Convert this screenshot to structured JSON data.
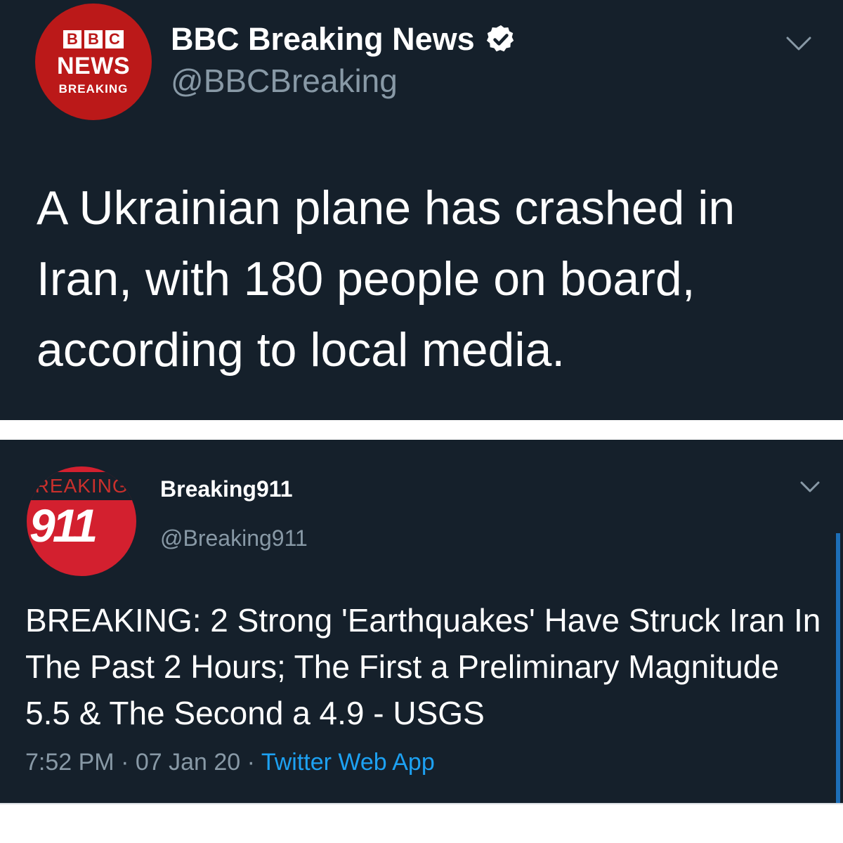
{
  "tweet1": {
    "avatar": {
      "blocks": [
        "B",
        "B",
        "C"
      ],
      "line1": "NEWS",
      "line2": "BREAKING"
    },
    "display_name": "BBC Breaking News",
    "handle": "@BBCBreaking",
    "verified": true,
    "text": "A Ukrainian plane has crashed in Iran, with 180 people on board, according to local media."
  },
  "tweet2": {
    "avatar": {
      "word": "BREAKING",
      "number": "911"
    },
    "display_name": "Breaking911",
    "handle": "@Breaking911",
    "text": "BREAKING: 2 Strong 'Earthquakes' Have Struck Iran In The Past 2 Hours; The First a Preliminary Magnitude 5.5 & The Second a 4.9 - USGS",
    "time": "7:52 PM",
    "date": "07 Jan 20",
    "separator": " · ",
    "source": "Twitter Web App"
  },
  "colors": {
    "background": "#15202b",
    "muted": "#8899a6",
    "link": "#1da1f2",
    "bbc_red": "#bb1919",
    "b911_red": "#d3202f"
  },
  "icons": {
    "verified": "verified-badge-icon",
    "menu": "chevron-down-icon"
  }
}
